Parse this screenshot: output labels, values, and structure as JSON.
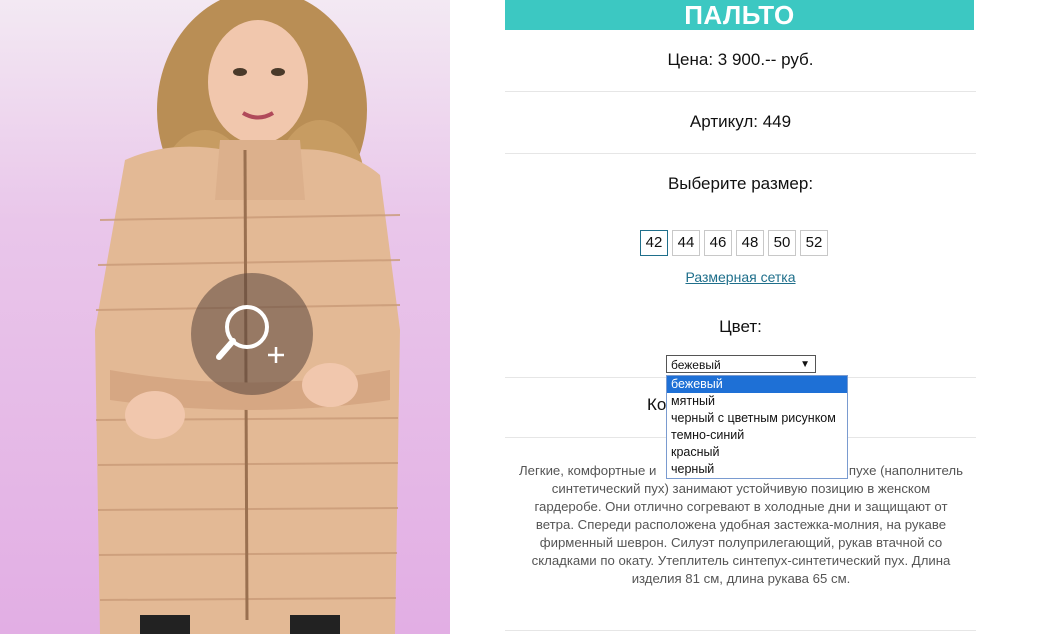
{
  "product": {
    "title": "ПАЛЬТО",
    "price": "Цена: 3 900.-- руб.",
    "article": "Артикул: 449",
    "size_prompt": "Выберите размер:",
    "sizes": [
      "42",
      "44",
      "46",
      "48",
      "50",
      "52"
    ],
    "selected_size": "42",
    "size_chart_link": "Размерная сетка",
    "color_label": "Цвет:",
    "color_selected": "бежевый",
    "color_options": [
      "бежевый",
      "мятный",
      "черный с цветным рисунком",
      "темно-синий",
      "красный",
      "черный"
    ],
    "hidden_label_fragment": "Ко",
    "description": "Легкие, комфортные и ... пухе (наполнитель синтетический пух) занимают устойчивую позицию в женском гардеробе. Они отлично согревают в холодные дни и защищают от ветра. Спереди расположена удобная застежка-молния, на рукаве фирменный шеврон. Силуэт полуприлегающий, рукав втачной со складками по окату. Утеплитель синтепух-синтетический пух. Длина изделия 81 см, длина рукава 65 см.",
    "description_lines": [
      "Легкие, комфортные и",
      "пухе (наполнитель",
      "синтетический пух) занимают устойчивую позицию в женском",
      "гардеробе. Они отлично согревают в холодные дни и защищают от",
      "ветра. Спереди расположена удобная застежка-молния, на рукаве",
      "фирменный шеврон. Силуэт полуприлегающий, рукав втачной со",
      "складками по окату. Утеплитель синтепух-синтетический пух. Длина",
      "изделия 81 см, длина рукава 65 см."
    ]
  },
  "colors": {
    "title_bg": "#3cc8c2",
    "link": "#1f6f8b",
    "dropdown_highlight": "#1e70d6"
  },
  "icons": {
    "zoom": "zoom-in-magnifier-icon",
    "select_arrow": "triangle-down-icon"
  }
}
